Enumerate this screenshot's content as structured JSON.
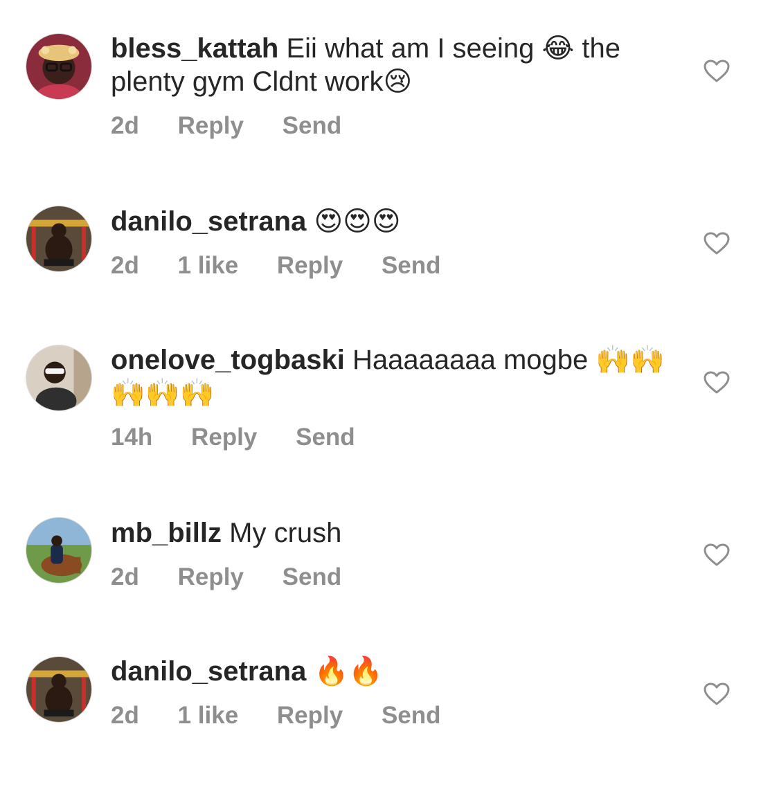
{
  "comments": [
    {
      "username": "bless_kattah",
      "text": "Eii what am I seeing 😂 the plenty gym Cldnt work😢",
      "time": "2d",
      "likes": "",
      "reply_label": "Reply",
      "send_label": "Send"
    },
    {
      "username": "danilo_setrana",
      "text": "😍😍😍",
      "time": "2d",
      "likes": "1 like",
      "reply_label": "Reply",
      "send_label": "Send"
    },
    {
      "username": "onelove_togbaski",
      "text": "Haaaaaaaa mogbe 🙌🙌🙌🙌🙌",
      "time": "14h",
      "likes": "",
      "reply_label": "Reply",
      "send_label": "Send"
    },
    {
      "username": "mb_billz",
      "text": "My crush",
      "time": "2d",
      "likes": "",
      "reply_label": "Reply",
      "send_label": "Send"
    },
    {
      "username": "danilo_setrana",
      "text": "🔥🔥",
      "time": "2d",
      "likes": "1 like",
      "reply_label": "Reply",
      "send_label": "Send"
    }
  ],
  "icons": {
    "heart": "heart-outline-icon",
    "avatar": "user-avatar-icon"
  },
  "colors": {
    "text": "#262626",
    "meta": "#8e8e8e",
    "heart_stroke": "#8e8e8e"
  }
}
